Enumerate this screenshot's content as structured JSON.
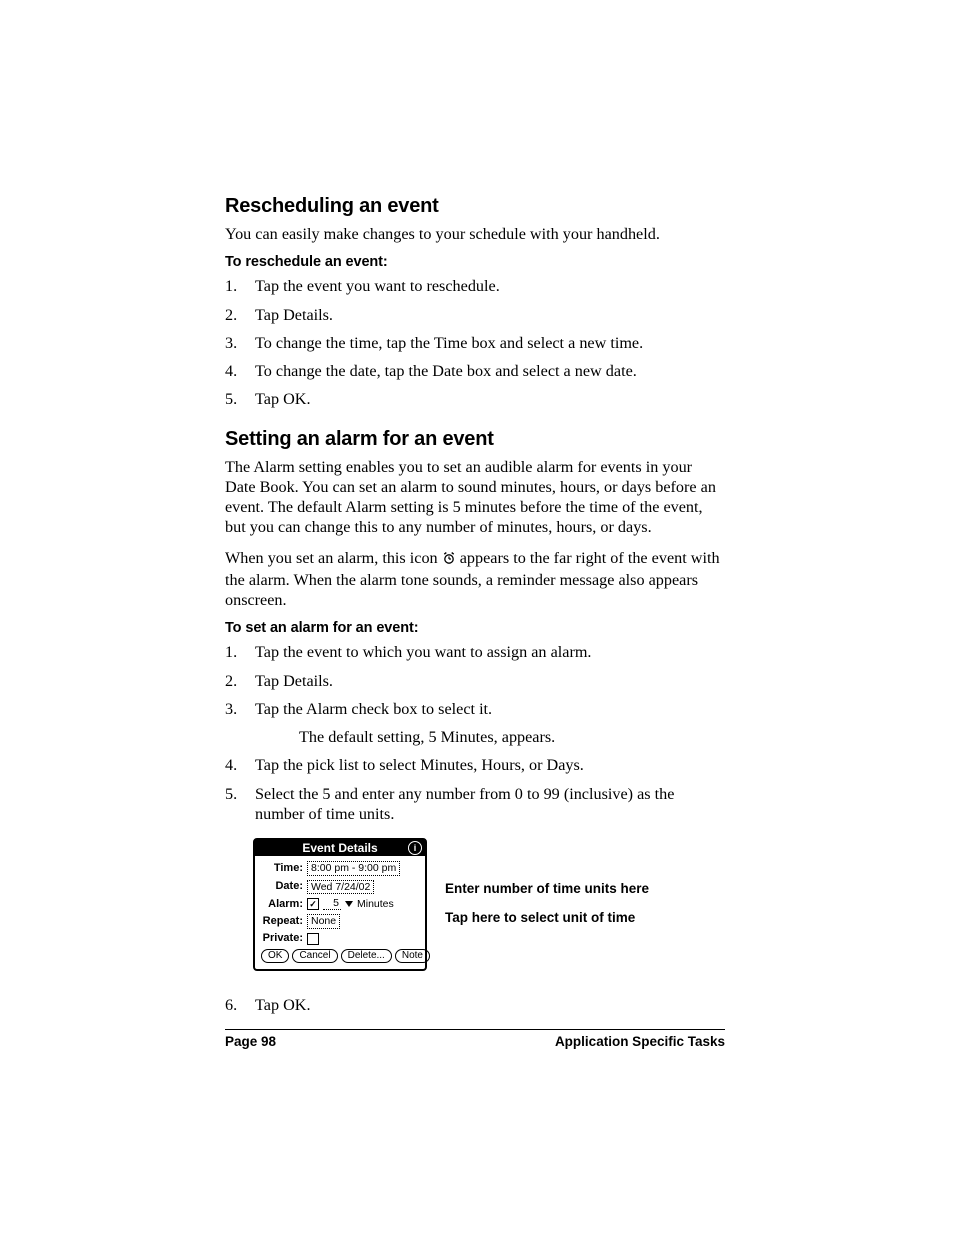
{
  "section1": {
    "heading": "Rescheduling an event",
    "intro": "You can easily make changes to your schedule with your handheld.",
    "sub_heading": "To reschedule an event:",
    "steps": [
      "Tap the event you want to reschedule.",
      "Tap Details.",
      "To change the time, tap the Time box and select a new time.",
      "To change the date, tap the Date box and select a new date.",
      "Tap OK."
    ]
  },
  "section2": {
    "heading": "Setting an alarm for an event",
    "para1": "The Alarm setting enables you to set an audible alarm for events in your Date Book. You can set an alarm to sound minutes, hours, or days before an event. The default Alarm setting is 5 minutes before the time of the event, but you can change this to any number of minutes, hours, or days.",
    "para2a": "When you set an alarm, this icon ",
    "para2b": " appears to the far right of the event with the alarm. When the alarm tone sounds, a reminder message also appears onscreen.",
    "sub_heading": "To set an alarm for an event:",
    "steps": [
      "Tap the event to which you want to assign an alarm.",
      "Tap Details.",
      "Tap the Alarm check box to select it.",
      "Tap the pick list to select Minutes, Hours, or Days.",
      "Select the 5 and enter any number from 0 to 99 (inclusive) as the number of time units.",
      "Tap OK."
    ],
    "step3_sub": "The default setting, 5 Minutes, appears."
  },
  "dialog": {
    "title": "Event Details",
    "rows": {
      "time_label": "Time:",
      "time_value": "8:00 pm - 9:00 pm",
      "date_label": "Date:",
      "date_value": "Wed 7/24/02",
      "alarm_label": "Alarm:",
      "alarm_value": "5",
      "alarm_unit": "Minutes",
      "repeat_label": "Repeat:",
      "repeat_value": "None",
      "private_label": "Private:"
    },
    "buttons": {
      "ok": "OK",
      "cancel": "Cancel",
      "delete": "Delete...",
      "note": "Note"
    }
  },
  "callouts": {
    "c1": "Enter number of time units here",
    "c2": "Tap here to select unit of time"
  },
  "footer": {
    "left": "Page 98",
    "right": "Application Specific Tasks"
  }
}
